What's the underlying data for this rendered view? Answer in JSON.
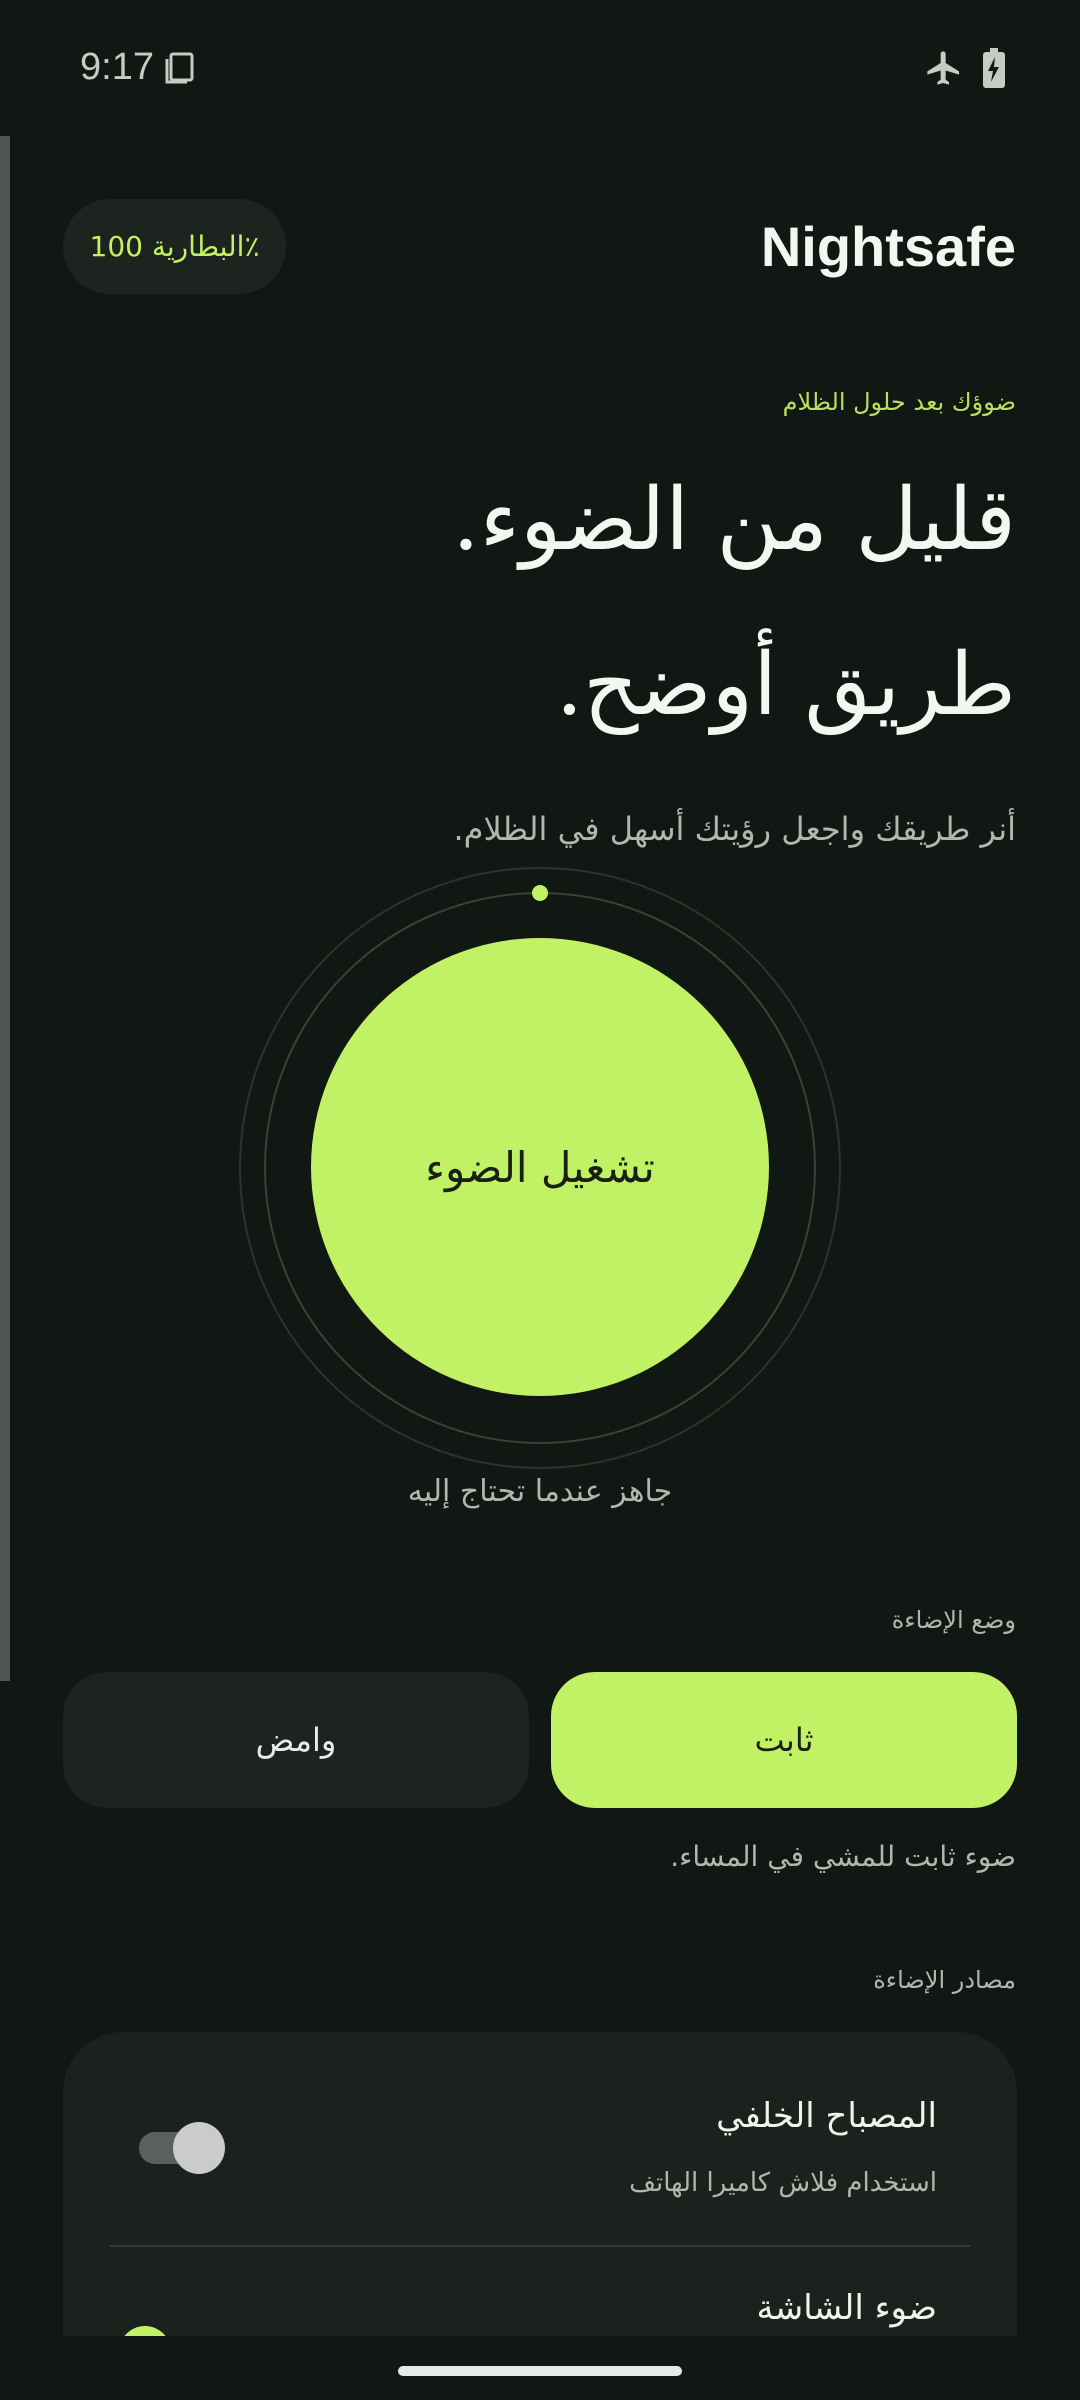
{
  "status_bar": {
    "time": "9:17",
    "icons": [
      "notification-icon",
      "airplane-icon",
      "battery-charging-icon"
    ]
  },
  "header": {
    "app_title": "Nightsafe",
    "battery_label": "البطارية 100٪"
  },
  "hero": {
    "tagline": "ضوؤك بعد حلول الظلام",
    "line1": "قليل من الضوء.",
    "line2": "طريق أوضح.",
    "subtitle": "أنر طريقك واجعل رؤيتك أسهل في الظلام."
  },
  "light_control": {
    "button_label": "تشغيل الضوء",
    "status_text": "جاهز عندما تحتاج إليه"
  },
  "mode": {
    "section_label": "وضع الإضاءة",
    "options": [
      {
        "label": "ثابت",
        "selected": true
      },
      {
        "label": "وامض",
        "selected": false
      }
    ],
    "description": "ضوء ثابت للمشي في المساء."
  },
  "sources": {
    "section_label": "مصادر الإضاءة",
    "items": [
      {
        "title": "المصباح الخلفي",
        "subtitle": "استخدام فلاش كاميرا الهاتف",
        "enabled": false
      },
      {
        "title": "ضوء الشاشة",
        "subtitle": "",
        "enabled": true
      }
    ]
  },
  "colors": {
    "background": "#111713",
    "surface": "#1d231f",
    "accent": "#c1f164",
    "text_primary": "#f4f6f1",
    "text_secondary": "#b1b6ae"
  }
}
